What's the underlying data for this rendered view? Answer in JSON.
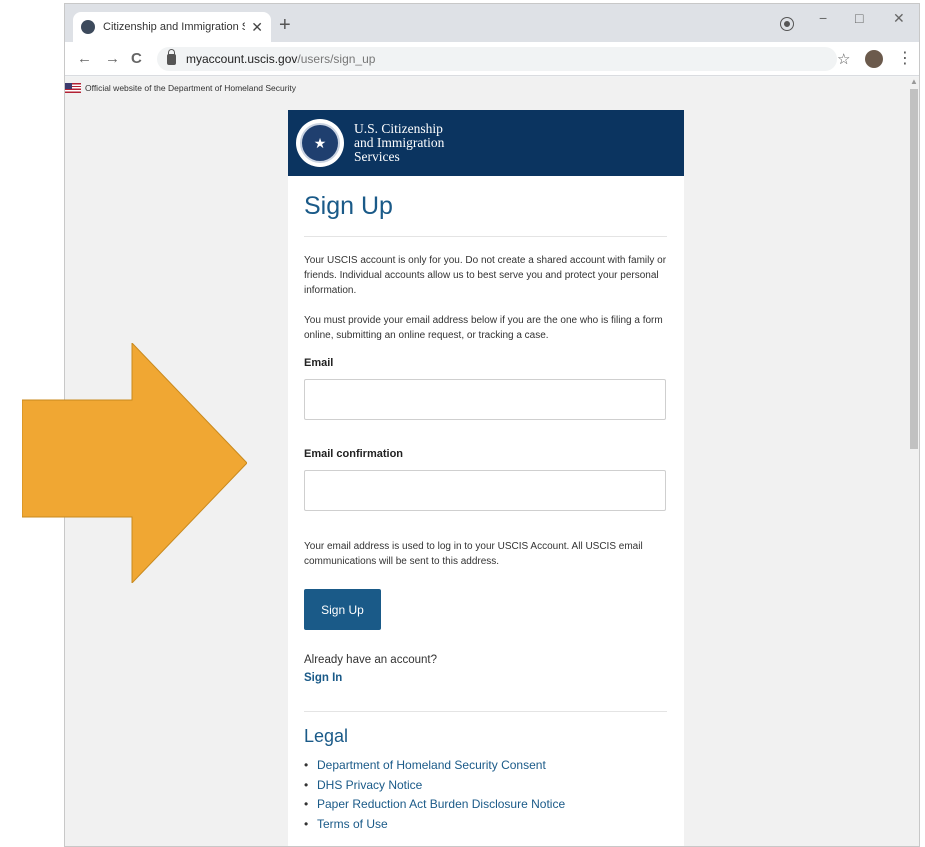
{
  "browser": {
    "tab_title": "Citizenship and Immigration Serv",
    "tab_close": "✕",
    "new_tab": "+",
    "url_host": "myaccount.uscis.gov",
    "url_path": "/users/sign_up",
    "back": "←",
    "forward": "→",
    "reload": "C",
    "star": "☆",
    "menu": "⋮",
    "minimize": "−",
    "maximize": "□",
    "close": "✕"
  },
  "banner": {
    "text": "Official website of the Department of Homeland Security"
  },
  "header": {
    "agency_line1": "U.S. Citizenship",
    "agency_line2": "and Immigration",
    "agency_line3": "Services"
  },
  "form": {
    "title": "Sign Up",
    "intro_1": "Your USCIS account is only for you. Do not create a shared account with family or friends. Individual accounts allow us to best serve you and protect your personal information.",
    "intro_2": "You must provide your email address below if you are the one who is filing a form online, submitting an online request, or tracking a case.",
    "email_label": "Email",
    "email_value": "",
    "confirm_label": "Email confirmation",
    "confirm_value": "",
    "note": "Your email address is used to log in to your USCIS Account. All USCIS email communications will be sent to this address.",
    "submit_label": "Sign Up",
    "already_text": "Already have an account?",
    "signin_label": "Sign In"
  },
  "legal": {
    "title": "Legal",
    "links": [
      "Department of Homeland Security Consent",
      "DHS Privacy Notice",
      "Paper Reduction Act Burden Disclosure Notice",
      "Terms of Use"
    ]
  },
  "colors": {
    "brand_navy": "#0b3460",
    "link_blue": "#1a5a88",
    "arrow_orange": "#f0a733"
  },
  "icons": {
    "arrow": "right-arrow-annotation",
    "seal": "dhs-seal"
  }
}
